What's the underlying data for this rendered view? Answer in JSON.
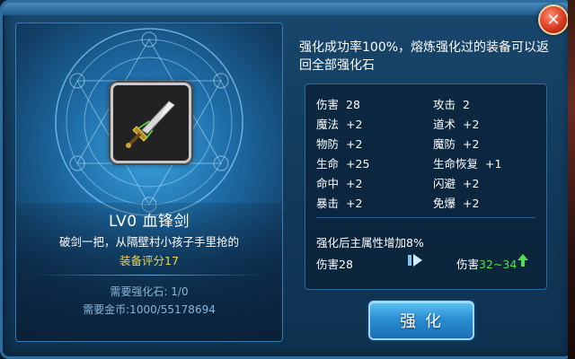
{
  "item": {
    "name": "LV0 血锋剑",
    "description": "破剑一把，从隔壁村小孩子手里抢的",
    "score": "装备评分17",
    "required_stone": "需要强化石: 1/0",
    "required_gold": "需要金币:1000/55178694"
  },
  "tip": "强化成功率100%，熔炼强化过的装备可以返回全部强化石",
  "stats": [
    {
      "label": "伤害",
      "value": "28"
    },
    {
      "label": "攻击",
      "value": "2"
    },
    {
      "label": "魔法",
      "value": "+2"
    },
    {
      "label": "道术",
      "value": "+2"
    },
    {
      "label": "物防",
      "value": "+2"
    },
    {
      "label": "魔防",
      "value": "+2"
    },
    {
      "label": "生命",
      "value": "+25"
    },
    {
      "label": "生命恢复",
      "value": "+1"
    },
    {
      "label": "命中",
      "value": "+2"
    },
    {
      "label": "闪避",
      "value": "+2"
    },
    {
      "label": "暴击",
      "value": "+2"
    },
    {
      "label": "免爆",
      "value": "+2"
    }
  ],
  "upgrade": {
    "title": "强化后主属性增加8%",
    "before_label": "伤害",
    "before_value": "28",
    "after_label": "伤害",
    "after_value": "32~34"
  },
  "enhance_button": "强化",
  "icons": {
    "close": "close-icon",
    "arrow": "arrow-right-icon",
    "up": "up-arrow-icon",
    "sword": "sword-icon"
  },
  "colors": {
    "score": "#f1d34a",
    "after_value": "#4fe04a",
    "button": "#2a8fd2"
  }
}
